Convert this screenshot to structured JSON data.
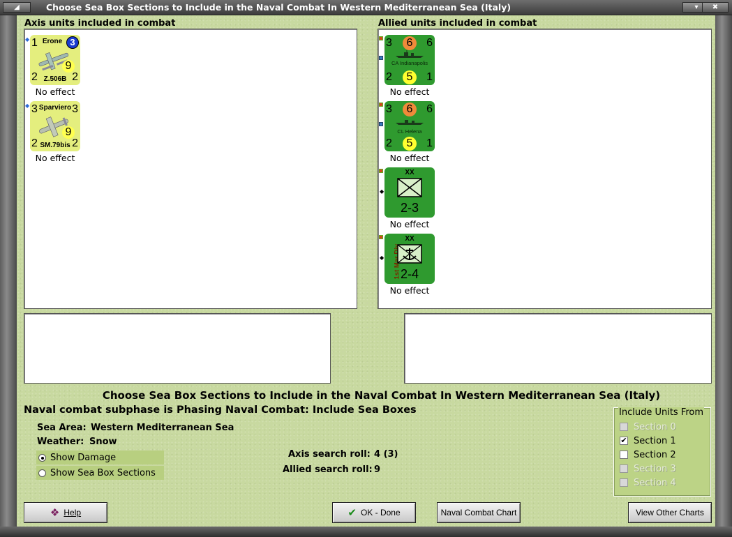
{
  "window": {
    "title": "Choose Sea Box Sections to Include in the Naval Combat In Western Mediterranean Sea (Italy)"
  },
  "axis_panel": {
    "header": "Axis units included in combat",
    "units": [
      {
        "name": "Erone",
        "model": "Z.506B",
        "top_left": "1",
        "circle": "3",
        "bottom_left": "2",
        "bottom_right": "2",
        "value": "9",
        "effect": "No effect"
      },
      {
        "name": "Sparviero",
        "model": "SM.79bis",
        "top_left": "3",
        "top_right": "3",
        "bottom_left": "2",
        "bottom_right": "2",
        "value": "9",
        "effect": "No effect"
      }
    ]
  },
  "allied_panel": {
    "header": "Allied units included in combat",
    "units": [
      {
        "type": "ship",
        "name": "CA Indianapolis",
        "top_left": "3",
        "top_mid": "6",
        "top_right": "6",
        "bottom_left": "2",
        "bottom_mid": "5",
        "bottom_right": "1",
        "effect": "No effect"
      },
      {
        "type": "ship",
        "name": "CL Helena",
        "top_left": "3",
        "top_mid": "6",
        "top_right": "6",
        "bottom_left": "2",
        "bottom_mid": "5",
        "bottom_right": "1",
        "effect": "No effect"
      },
      {
        "type": "division",
        "size": "XX",
        "strength": "2-3",
        "effect": "No effect"
      },
      {
        "type": "marine",
        "size": "XX",
        "label": "1st Mar Div",
        "strength": "2-4",
        "effect": "No effect"
      }
    ]
  },
  "main": {
    "title": "Choose Sea Box Sections to Include in the Naval Combat In Western Mediterranean Sea (Italy)",
    "subphase": "Naval combat subphase is Phasing Naval Combat: Include Sea Boxes",
    "sea_area_label": "Sea Area:",
    "sea_area_value": "Western Mediterranean Sea",
    "weather_label": "Weather:",
    "weather_value": "Snow",
    "show_damage": "Show Damage",
    "show_sea_box": "Show Sea Box Sections",
    "axis_roll_label": "Axis search roll:",
    "axis_roll_value": "4 (3)",
    "allied_roll_label": "Allied search roll:",
    "allied_roll_value": "9"
  },
  "include": {
    "legend": "Include Units From",
    "sections": [
      {
        "label": "Section 0",
        "checked": false,
        "enabled": false
      },
      {
        "label": "Section 1",
        "checked": true,
        "enabled": true
      },
      {
        "label": "Section 2",
        "checked": false,
        "enabled": true
      },
      {
        "label": "Section 3",
        "checked": false,
        "enabled": false
      },
      {
        "label": "Section 4",
        "checked": false,
        "enabled": false
      }
    ]
  },
  "buttons": {
    "help": "Help",
    "ok": "OK - Done",
    "naval_chart": "Naval Combat Chart",
    "other_charts": "View Other Charts"
  }
}
